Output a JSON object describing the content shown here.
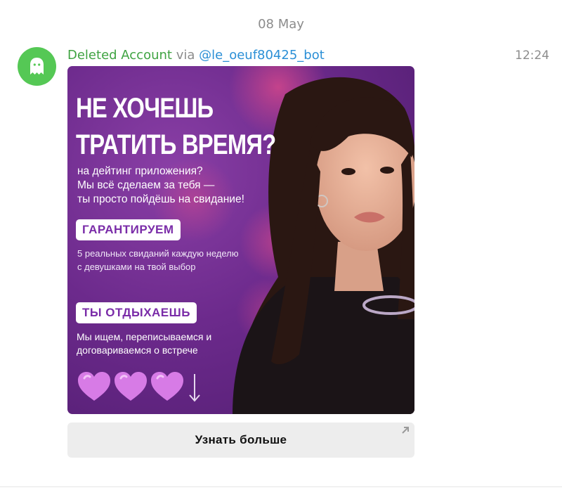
{
  "date_separator": "08 May",
  "message": {
    "sender": "Deleted Account",
    "via_label": "via",
    "bot_handle": "@le_oeuf80425_bot",
    "time": "12:24",
    "avatar_icon": "ghost-icon",
    "ad": {
      "headline_line1": "НЕ ХОЧЕШЬ",
      "headline_line2": "ТРАТИТЬ ВРЕМЯ?",
      "subtext_line1": "на дейтинг приложения?",
      "subtext_line2": "Мы всё сделаем за тебя —",
      "subtext_line3": "ты просто пойдёшь на свидание!",
      "pill1": "ГАРАНТИРУЕМ",
      "note1": "5 реальных свиданий каждую неделю с девушками на твой выбор",
      "pill2": "ТЫ ОТДЫХАЕШЬ",
      "note2": "Мы ищем, переписываемся и договариваемся о встрече",
      "accent_color": "#7a2ca8",
      "heart_color": "#d77be6"
    },
    "button_label": "Узнать больше",
    "button_icon": "external-link-icon"
  }
}
